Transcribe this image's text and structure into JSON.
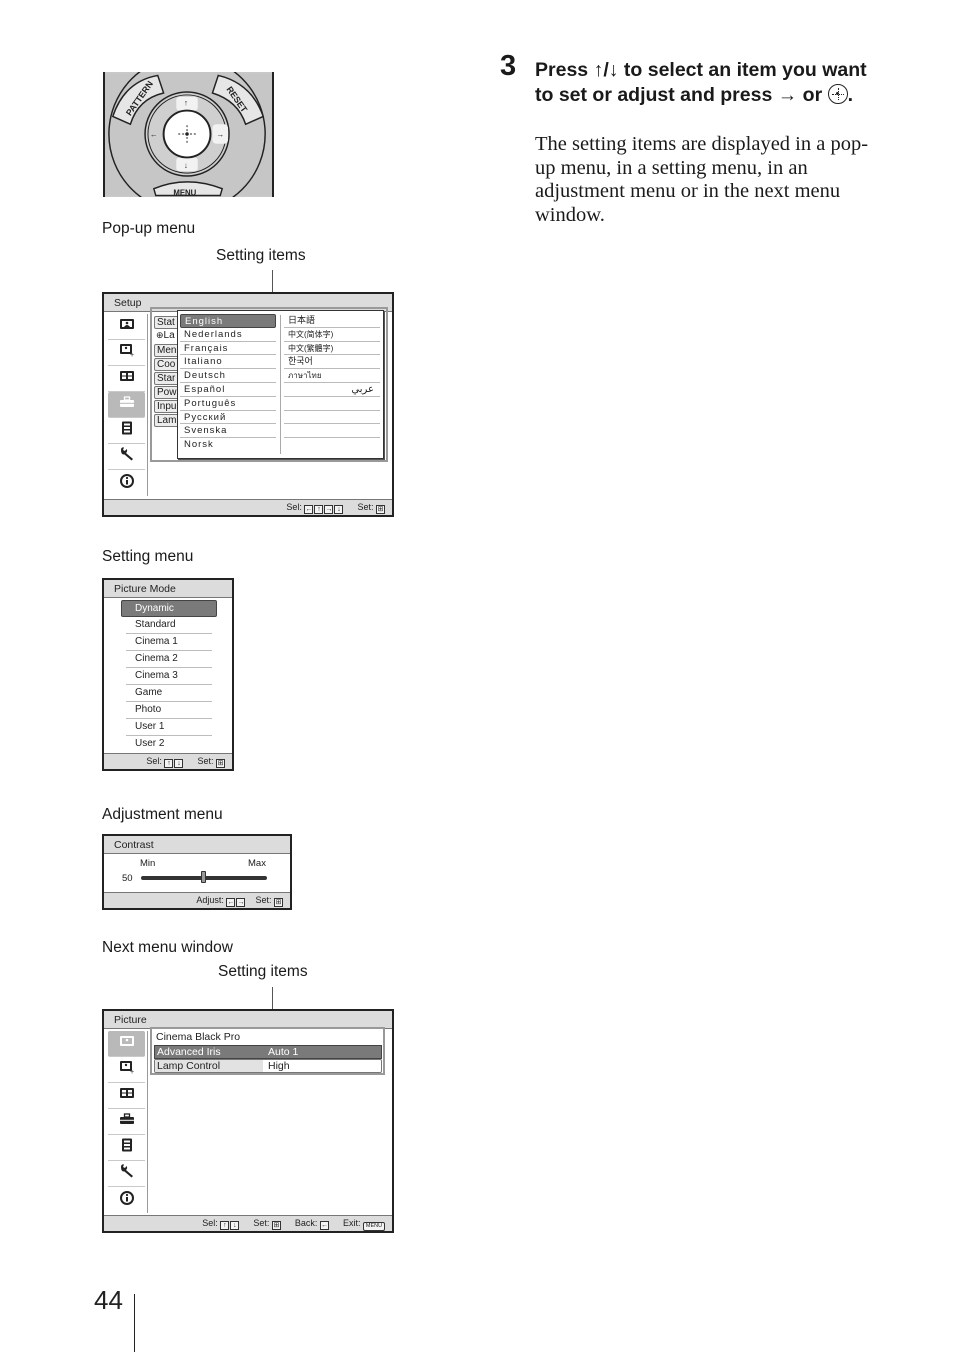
{
  "step": {
    "number": "3",
    "heading_prefix": "Press ",
    "heading_arrows": "↑/↓",
    "heading_mid": " to select an item you want to set or adjust and press ",
    "heading_arrow_right": "→",
    "heading_or": " or ",
    "heading_end": ".",
    "body": "The setting items are displayed in a pop-up menu, in a setting menu, in an adjustment menu or in the next menu window."
  },
  "remote": {
    "pattern_label": "PATTERN",
    "reset_label": "RESET",
    "menu_label": "MENU"
  },
  "popup_section": {
    "caption": "Pop-up menu",
    "callout": "Setting items",
    "window_title": "Setup",
    "background_items": [
      "Stat",
      "La",
      "Men",
      "Coo",
      "Star",
      "Pow",
      "Inpu",
      "Lam"
    ],
    "languages_left": [
      "English",
      "Nederlands",
      "Français",
      "Italiano",
      "Deutsch",
      "Español",
      "Português",
      "Русский",
      "Svenska",
      "Norsk"
    ],
    "languages_right": [
      "日本語",
      "中文(简体字)",
      "中文(繁體字)",
      "한국어",
      "ภาษาไทย",
      "عربي",
      "",
      "",
      "",
      ""
    ],
    "selected_language": "English",
    "footer": {
      "sel_label": "Sel:",
      "sel_keys": [
        "←",
        "↑",
        "→",
        "↓"
      ],
      "set_label": "Set:",
      "set_key": "⊞"
    }
  },
  "sidebar_icons": [
    "picture-icon",
    "picture-advanced-icon",
    "screen-icon",
    "setup-toolbox-icon",
    "function-icon",
    "installation-wrench-icon",
    "information-icon"
  ],
  "setting_section": {
    "caption": "Setting menu",
    "window_title": "Picture Mode",
    "items": [
      "Dynamic",
      "Standard",
      "Cinema 1",
      "Cinema 2",
      "Cinema 3",
      "Game",
      "Photo",
      "User 1",
      "User 2"
    ],
    "selected": "Dynamic",
    "footer": {
      "sel_label": "Sel:",
      "sel_keys": [
        "↑",
        "↓"
      ],
      "set_label": "Set:",
      "set_key": "⊞"
    }
  },
  "adjustment_section": {
    "caption": "Adjustment menu",
    "window_title": "Contrast",
    "min_label": "Min",
    "max_label": "Max",
    "value": "50",
    "slider_fraction": 0.5,
    "footer": {
      "adjust_label": "Adjust:",
      "adjust_keys": [
        "←",
        "→"
      ],
      "set_label": "Set:",
      "set_key": "⊞"
    }
  },
  "next_section": {
    "caption": "Next menu window",
    "callout": "Setting items",
    "window_title": "Picture",
    "rows": [
      {
        "label": "Cinema Black Pro",
        "value": ""
      },
      {
        "label": "Advanced Iris",
        "value": "Auto 1"
      },
      {
        "label": "Lamp Control",
        "value": "High"
      }
    ],
    "footer": {
      "sel_label": "Sel:",
      "sel_keys": [
        "↑",
        "↓"
      ],
      "set_label": "Set:",
      "set_key": "⊞",
      "back_label": "Back:",
      "back_key": "←",
      "exit_label": "Exit:",
      "exit_key": "MENU"
    }
  },
  "page_number": "44"
}
